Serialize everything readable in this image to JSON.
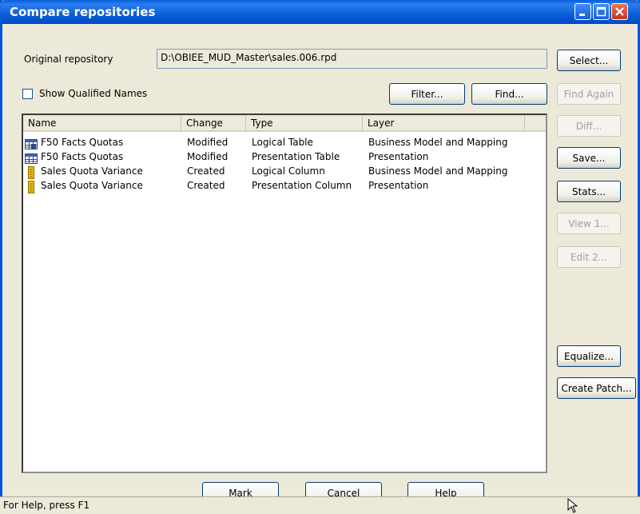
{
  "window": {
    "title": "Compare repositories"
  },
  "original": {
    "label": "Original repository",
    "path": "D:\\OBIEE_MUD_Master\\sales.006.rpd"
  },
  "options": {
    "show_qualified_label": "Show Qualified Names",
    "show_qualified_checked": false
  },
  "buttons": {
    "select": "Select...",
    "filter": "Filter...",
    "find": "Find...",
    "find_again": "Find Again",
    "diff": "Diff...",
    "save": "Save...",
    "stats": "Stats...",
    "view1": "View 1...",
    "edit2": "Edit 2...",
    "equalize": "Equalize...",
    "create_patch": "Create Patch...",
    "mark": "Mark",
    "cancel": "Cancel",
    "help": "Help"
  },
  "table": {
    "columns": [
      "Name",
      "Change",
      "Type",
      "Layer"
    ],
    "rows": [
      {
        "name": "F50 Facts Quotas",
        "change": "Modified",
        "type": "Logical Table",
        "layer": "Business Model and Mapping",
        "icon": "logical-table-icon"
      },
      {
        "name": "F50 Facts Quotas",
        "change": "Modified",
        "type": "Presentation Table",
        "layer": "Presentation",
        "icon": "presentation-table-icon"
      },
      {
        "name": "Sales Quota Variance",
        "change": "Created",
        "type": "Logical Column",
        "layer": "Business Model and Mapping",
        "icon": "column-icon"
      },
      {
        "name": "Sales Quota Variance",
        "change": "Created",
        "type": "Presentation Column",
        "layer": "Presentation",
        "icon": "column-icon"
      }
    ]
  },
  "status": {
    "text": "For Help, press F1"
  },
  "colors": {
    "titlebar": "#0a5fd8",
    "dialog": "#ece9d8",
    "close": "#c4361a"
  }
}
